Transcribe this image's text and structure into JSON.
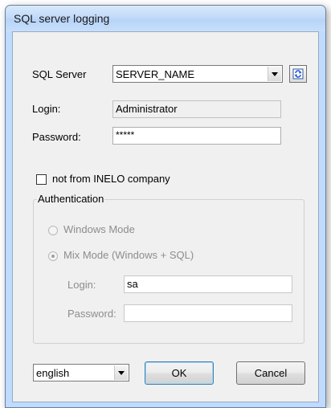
{
  "window": {
    "title": "SQL server logging"
  },
  "server": {
    "label": "SQL Server",
    "value": "SERVER_NAME",
    "refresh_icon": "refresh-icon"
  },
  "login": {
    "label": "Login:",
    "value": "Administrator"
  },
  "password": {
    "label": "Password:",
    "value": "*****"
  },
  "not_inelo": {
    "label": "not from INELO company",
    "checked": false
  },
  "auth": {
    "title": "Authentication",
    "windows_mode": "Windows Mode",
    "mix_mode": "Mix Mode (Windows + SQL)",
    "selected": "mix_mode",
    "login_label": "Login:",
    "login_value": "sa",
    "password_label": "Password:",
    "password_value": ""
  },
  "footer": {
    "language": "english",
    "ok_label": "OK",
    "cancel_label": "Cancel"
  }
}
